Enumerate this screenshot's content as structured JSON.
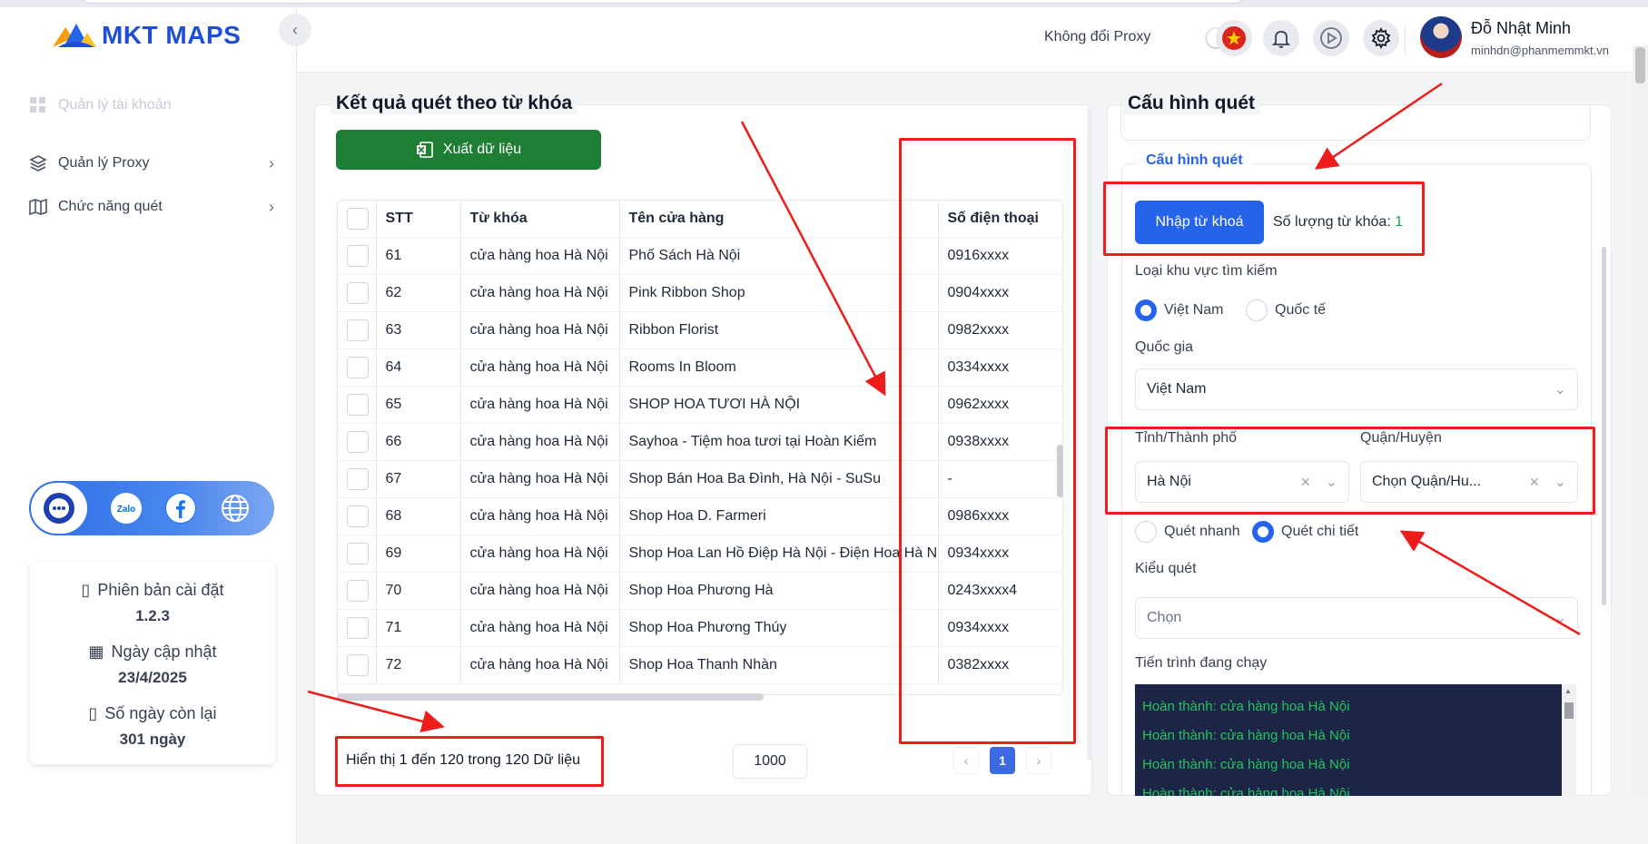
{
  "app": {
    "logo_text": "MKT MAPS",
    "brand_color": "#1d4ed8"
  },
  "sidebar": {
    "items": [
      {
        "label": "Quản lý tài khoản",
        "icon": "grid-icon",
        "disabled": true
      },
      {
        "label": "Quản lý Proxy",
        "icon": "layers-icon",
        "has_chevron": true
      },
      {
        "label": "Chức năng quét",
        "icon": "map-icon",
        "has_chevron": true
      }
    ],
    "social": [
      "support-chat-icon",
      "zalo-icon",
      "facebook-icon",
      "globe-icon"
    ],
    "info": {
      "version_label": "Phiên bản cài đặt",
      "version_value": "1.2.3",
      "updated_label": "Ngày cập nhật",
      "updated_value": "23/4/2025",
      "remaining_label": "Số ngày còn lại",
      "remaining_value": "301 ngày"
    }
  },
  "header": {
    "proxy_label": "Không đổi Proxy",
    "proxy_toggle_on": false,
    "user_name": "Đỗ Nhật Minh",
    "user_email": "minhdn@phanmemmkt.vn"
  },
  "results": {
    "title": "Kết quả quét theo từ khóa",
    "export_label": "Xuất dữ liệu",
    "columns": [
      "STT",
      "Từ khóa",
      "Tên cửa hàng",
      "Số điện thoại"
    ],
    "rows": [
      {
        "stt": "61",
        "keyword": "cửa hàng hoa Hà Nội",
        "store": "Phố Sách Hà Nội",
        "phone": "0916xxxx"
      },
      {
        "stt": "62",
        "keyword": "cửa hàng hoa Hà Nội",
        "store": "Pink Ribbon Shop",
        "phone": "0904xxxx"
      },
      {
        "stt": "63",
        "keyword": "cửa hàng hoa Hà Nội",
        "store": "Ribbon Florist",
        "phone": "0982xxxx"
      },
      {
        "stt": "64",
        "keyword": "cửa hàng hoa Hà Nội",
        "store": "Rooms In Bloom",
        "phone": "0334xxxx"
      },
      {
        "stt": "65",
        "keyword": "cửa hàng hoa Hà Nội",
        "store": "SHOP HOA TƯƠI HÀ NỘI",
        "phone": "0962xxxx"
      },
      {
        "stt": "66",
        "keyword": "cửa hàng hoa Hà Nội",
        "store": "Sayhoa - Tiệm hoa tươi tại Hoàn Kiếm",
        "phone": "0938xxxx"
      },
      {
        "stt": "67",
        "keyword": "cửa hàng hoa Hà Nội",
        "store": "Shop Bán Hoa Ba Đình, Hà Nội - SuSu",
        "phone": "-"
      },
      {
        "stt": "68",
        "keyword": "cửa hàng hoa Hà Nội",
        "store": "Shop Hoa D. Farmeri",
        "phone": "0986xxxx"
      },
      {
        "stt": "69",
        "keyword": "cửa hàng hoa Hà Nội",
        "store": "Shop Hoa Lan Hồ Điệp Hà Nội - Điện Hoa Hà N",
        "phone": "0934xxxx"
      },
      {
        "stt": "70",
        "keyword": "cửa hàng hoa Hà Nội",
        "store": "Shop Hoa Phương Hà",
        "phone": "0243xxxx4"
      },
      {
        "stt": "71",
        "keyword": "cửa hàng hoa Hà Nội",
        "store": "Shop Hoa Phương Thúy",
        "phone": "0934xxxx"
      },
      {
        "stt": "72",
        "keyword": "cửa hàng hoa Hà Nội",
        "store": "Shop Hoa Thanh Nhàn",
        "phone": "0382xxxx"
      }
    ],
    "footer_text": "Hiển thị 1 đến 120 trong 120 Dữ liệu",
    "page_size": "1000",
    "pagination": {
      "prev": "‹",
      "current": "1",
      "next": "›"
    }
  },
  "config": {
    "title": "Cấu hình quét",
    "legend": "Cấu hình quét",
    "import_label": "Nhập từ khoá",
    "keyword_count_label": "Số lượng từ khóa:",
    "keyword_count_value": "1",
    "area_type_label": "Loại khu vực tìm kiếm",
    "area_options": [
      "Việt Nam",
      "Quốc tế"
    ],
    "area_selected": "Việt Nam",
    "country_label": "Quốc gia",
    "country_value": "Việt Nam",
    "province_label": "Tỉnh/Thành phố",
    "province_value": "Hà Nội",
    "district_label": "Quận/Huyện",
    "district_value": "Chọn Quận/Hu...",
    "scan_modes": [
      "Quét nhanh",
      "Quét chi tiết"
    ],
    "scan_mode_selected": "Quét chi tiết",
    "scan_type_label": "Kiểu quét",
    "scan_type_value": "Chọn",
    "progress_label": "Tiến trình đang chạy",
    "log_lines": [
      "Hoàn thành: cửa hàng hoa Hà Nội",
      "Hoàn thành: cửa hàng hoa Hà Nội",
      "Hoàn thành: cửa hàng hoa Hà Nội",
      "Hoàn thành: cửa hàng hoa Hà Nội"
    ]
  },
  "colors": {
    "primary": "#2563eb",
    "export_green": "#1e7e34",
    "log_bg": "#1c2545",
    "log_text": "#22c55e",
    "annotation_red": "#ef1c1c"
  }
}
